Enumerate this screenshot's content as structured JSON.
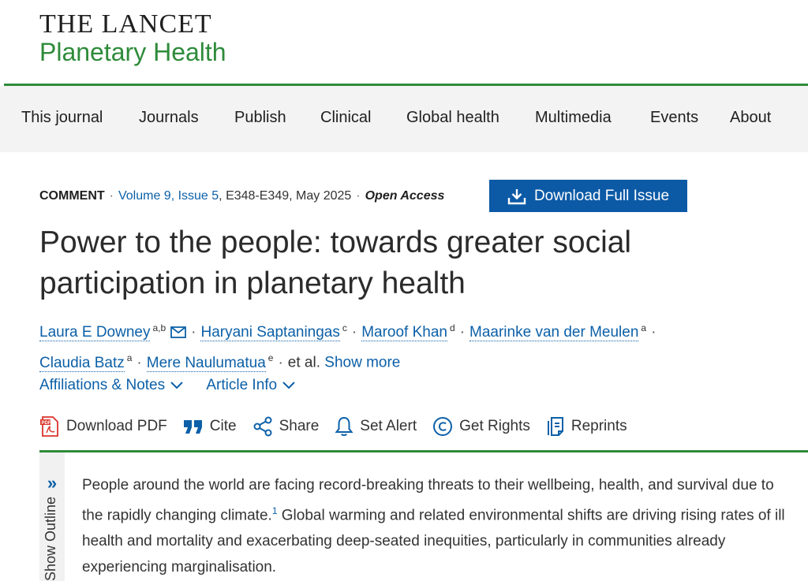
{
  "brand": {
    "line1": "THE LANCET",
    "line2": "Planetary Health"
  },
  "nav": [
    "This journal",
    "Journals",
    "Publish",
    "Clinical",
    "Global health",
    "Multimedia",
    "Events",
    "About"
  ],
  "meta": {
    "type": "COMMENT",
    "volume": "Volume 9, Issue 5",
    "pages": ", E348-E349, May 2025",
    "access": "Open Access",
    "download_issue": "Download Full Issue"
  },
  "article": {
    "title": "Power to the people: towards greater social participation in planetary health",
    "authors": [
      {
        "name": "Laura E Downey",
        "aff": "a,b"
      },
      {
        "name": "Haryani Saptaningas",
        "aff": "c"
      },
      {
        "name": "Maroof Khan",
        "aff": "d"
      },
      {
        "name": "Maarinke van der Meulen",
        "aff": "a"
      },
      {
        "name": "Claudia Batz",
        "aff": "a"
      },
      {
        "name": "Mere Naulumatua",
        "aff": "e"
      }
    ],
    "et_al": "et al.",
    "show_more": "Show more",
    "affiliations": "Affiliations & Notes",
    "article_info": "Article Info"
  },
  "actions": {
    "download_pdf": "Download PDF",
    "cite": "Cite",
    "share": "Share",
    "set_alert": "Set Alert",
    "get_rights": "Get Rights",
    "reprints": "Reprints"
  },
  "outline": {
    "label": "Show Outline"
  },
  "body": {
    "p1_a": "People around the world are facing record-breaking threats to their wellbeing, health, and survival due to the rapidly changing climate.",
    "p1_ref": "1",
    "p1_b": " Global warming and related environmental shifts are driving rising rates of ill health and mortality and exacerbating deep-seated inequities, particularly in communities already experiencing marginalisation."
  },
  "colors": {
    "brand_green": "#2e8b3a",
    "link_blue": "#0c60a8",
    "button_blue": "#0c5aa6"
  }
}
